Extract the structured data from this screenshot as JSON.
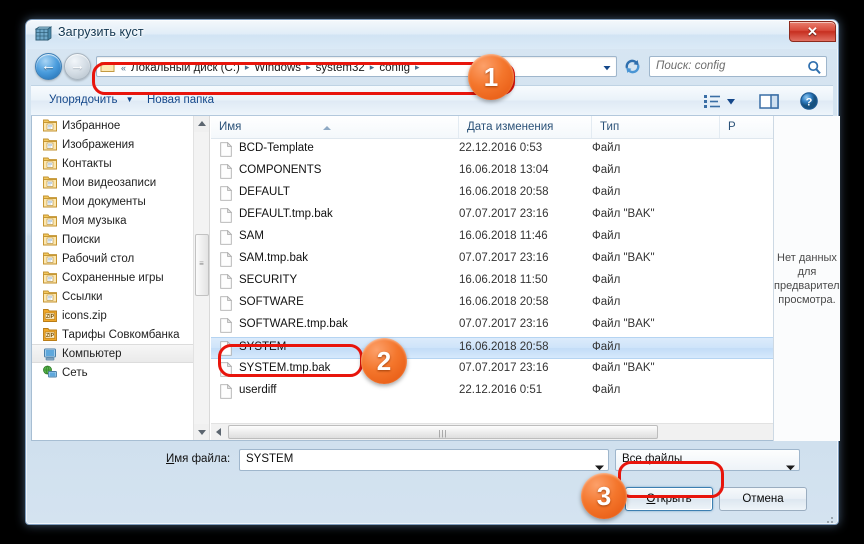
{
  "window": {
    "title": "Загрузить куст",
    "title_icon": "registry-icon",
    "close_label": "✕"
  },
  "nav": {
    "back_icon": "back-arrow-icon",
    "forward_icon": "forward-arrow-icon",
    "back_glyph": "←",
    "forward_glyph": "→",
    "refresh_icon": "refresh-icon",
    "address_folder_icon": "folder-icon",
    "overflow": "«",
    "breadcrumbs": [
      "Локальный диск (C:)",
      "Windows",
      "system32",
      "config"
    ],
    "separator": "▸",
    "dropdown_icon": "chevron-down-icon"
  },
  "search": {
    "placeholder": "Поиск: config",
    "icon": "search-icon"
  },
  "toolbar": {
    "organize_label": "Упорядочить",
    "organize_caret": "▼",
    "new_folder_label": "Новая папка",
    "view_icon": "view-mode-icon",
    "view_caret": "▼",
    "preview_icon": "preview-pane-icon",
    "help_icon": "help-icon"
  },
  "sidebar": {
    "items": [
      {
        "label": "Избранное",
        "icon": "folder-favorites-icon",
        "selected": false
      },
      {
        "label": "Изображения",
        "icon": "folder-pictures-icon",
        "selected": false
      },
      {
        "label": "Контакты",
        "icon": "folder-contacts-icon",
        "selected": false
      },
      {
        "label": "Мои видеозаписи",
        "icon": "folder-videos-icon",
        "selected": false
      },
      {
        "label": "Мои документы",
        "icon": "folder-documents-icon",
        "selected": false
      },
      {
        "label": "Моя музыка",
        "icon": "folder-music-icon",
        "selected": false
      },
      {
        "label": "Поиски",
        "icon": "folder-searches-icon",
        "selected": false
      },
      {
        "label": "Рабочий стол",
        "icon": "folder-desktop-icon",
        "selected": false
      },
      {
        "label": "Сохраненные игры",
        "icon": "folder-savedgames-icon",
        "selected": false
      },
      {
        "label": "Ссылки",
        "icon": "folder-links-icon",
        "selected": false
      },
      {
        "label": "icons.zip",
        "icon": "zip-icon",
        "selected": false
      },
      {
        "label": "Тарифы Совкомбанка",
        "icon": "zip-icon",
        "selected": false
      },
      {
        "label": "Компьютер",
        "icon": "computer-icon",
        "selected": true
      },
      {
        "label": "Сеть",
        "icon": "network-icon",
        "selected": false
      }
    ]
  },
  "filelist": {
    "columns": [
      {
        "key": "name",
        "label": "Имя"
      },
      {
        "key": "date",
        "label": "Дата изменения"
      },
      {
        "key": "type",
        "label": "Тип"
      },
      {
        "key": "size",
        "label": "Р"
      }
    ],
    "sort_icon": "sort-ascending-icon",
    "file_icon": "file-icon",
    "rows": [
      {
        "name": "BCD-Template",
        "date": "22.12.2016 0:53",
        "type": "Файл",
        "selected": false
      },
      {
        "name": "COMPONENTS",
        "date": "16.06.2018 13:04",
        "type": "Файл",
        "selected": false
      },
      {
        "name": "DEFAULT",
        "date": "16.06.2018 20:58",
        "type": "Файл",
        "selected": false
      },
      {
        "name": "DEFAULT.tmp.bak",
        "date": "07.07.2017 23:16",
        "type": "Файл \"BAK\"",
        "selected": false
      },
      {
        "name": "SAM",
        "date": "16.06.2018 11:46",
        "type": "Файл",
        "selected": false
      },
      {
        "name": "SAM.tmp.bak",
        "date": "07.07.2017 23:16",
        "type": "Файл \"BAK\"",
        "selected": false
      },
      {
        "name": "SECURITY",
        "date": "16.06.2018 11:50",
        "type": "Файл",
        "selected": false
      },
      {
        "name": "SOFTWARE",
        "date": "16.06.2018 20:58",
        "type": "Файл",
        "selected": false
      },
      {
        "name": "SOFTWARE.tmp.bak",
        "date": "07.07.2017 23:16",
        "type": "Файл \"BAK\"",
        "selected": false
      },
      {
        "name": "SYSTEM",
        "date": "16.06.2018 20:58",
        "type": "Файл",
        "selected": true
      },
      {
        "name": "SYSTEM.tmp.bak",
        "date": "07.07.2017 23:16",
        "type": "Файл \"BAK\"",
        "selected": false
      },
      {
        "name": "userdiff",
        "date": "22.12.2016 0:51",
        "type": "Файл",
        "selected": false
      }
    ]
  },
  "preview": {
    "text": "Нет данных для предварительного просмотра."
  },
  "bottom": {
    "filename_label_prefix": "И",
    "filename_label_rest": "мя файла:",
    "filename_value": "SYSTEM",
    "filter_value": "Все файлы",
    "open_button_prefix": "О",
    "open_button_rest": "ткрыть",
    "cancel_button": "Отмена"
  },
  "annotations": {
    "callouts": [
      {
        "number": "1",
        "target": "address-bar"
      },
      {
        "number": "2",
        "target": "system-file-row"
      },
      {
        "number": "3",
        "target": "open-button"
      }
    ],
    "highlight_color": "#e8150c",
    "callout_color": "#f4762c"
  }
}
